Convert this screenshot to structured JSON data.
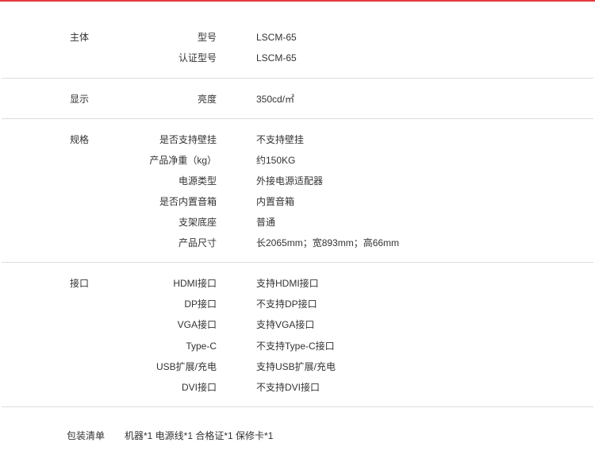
{
  "sections": [
    {
      "label": "主体",
      "rows": [
        {
          "key": "型号",
          "value": "LSCM-65"
        },
        {
          "key": "认证型号",
          "value": "LSCM-65"
        }
      ]
    },
    {
      "label": "显示",
      "rows": [
        {
          "key": "亮度",
          "value": "350cd/㎡"
        }
      ]
    },
    {
      "label": "规格",
      "rows": [
        {
          "key": "是否支持壁挂",
          "value": "不支持壁挂"
        },
        {
          "key": "产品净重（kg）",
          "value": "约150KG"
        },
        {
          "key": "电源类型",
          "value": "外接电源适配器"
        },
        {
          "key": "是否内置音箱",
          "value": "内置音箱"
        },
        {
          "key": "支架底座",
          "value": "普通"
        },
        {
          "key": "产品尺寸",
          "value": "长2065mm；宽893mm；高66mm"
        }
      ]
    },
    {
      "label": "接口",
      "rows": [
        {
          "key": "HDMI接口",
          "value": "支持HDMI接口"
        },
        {
          "key": "DP接口",
          "value": "不支持DP接口"
        },
        {
          "key": "VGA接口",
          "value": "支持VGA接口"
        },
        {
          "key": "Type-C",
          "value": "不支持Type-C接口"
        },
        {
          "key": "USB扩展/充电",
          "value": "支持USB扩展/充电"
        },
        {
          "key": "DVI接口",
          "value": "不支持DVI接口"
        }
      ]
    }
  ],
  "package": {
    "label": "包装清单",
    "value": "机器*1 电源线*1 合格证*1 保修卡*1"
  }
}
